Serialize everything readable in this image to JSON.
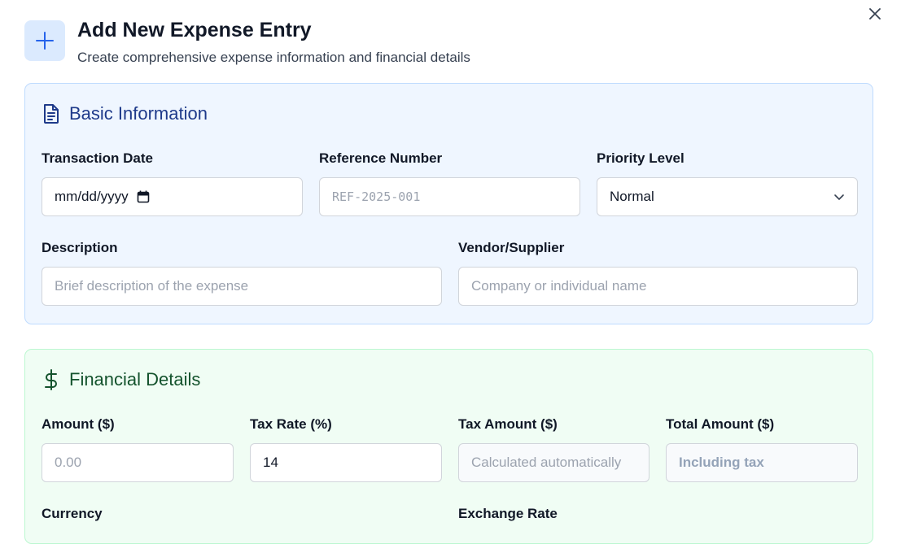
{
  "header": {
    "title": "Add New Expense Entry",
    "subtitle": "Create comprehensive expense information and financial details",
    "icon": "plus-icon",
    "close_icon": "close-icon"
  },
  "basic": {
    "title": "Basic Information",
    "icon": "document-icon",
    "transaction_date": {
      "label": "Transaction Date",
      "value": "mm/dd/yyyy"
    },
    "reference_number": {
      "label": "Reference Number",
      "placeholder": "REF-2025-001"
    },
    "priority_level": {
      "label": "Priority Level",
      "value": "Normal"
    },
    "description": {
      "label": "Description",
      "placeholder": "Brief description of the expense"
    },
    "vendor": {
      "label": "Vendor/Supplier",
      "placeholder": "Company or individual name"
    }
  },
  "financial": {
    "title": "Financial Details",
    "icon": "dollar-icon",
    "amount": {
      "label": "Amount ($)",
      "placeholder": "0.00"
    },
    "tax_rate": {
      "label": "Tax Rate (%)",
      "value": "14"
    },
    "tax_amount": {
      "label": "Tax Amount ($)",
      "placeholder": "Calculated automatically"
    },
    "total_amount": {
      "label": "Total Amount ($)",
      "placeholder": "Including tax"
    },
    "currency": {
      "label": "Currency"
    },
    "exchange_rate": {
      "label": "Exchange Rate"
    }
  },
  "colors": {
    "accent": "#2563eb",
    "basic_bg": "#eff6ff",
    "basic_title": "#1e3a8a",
    "financial_bg": "#f0fdf4",
    "financial_title": "#14532d"
  }
}
